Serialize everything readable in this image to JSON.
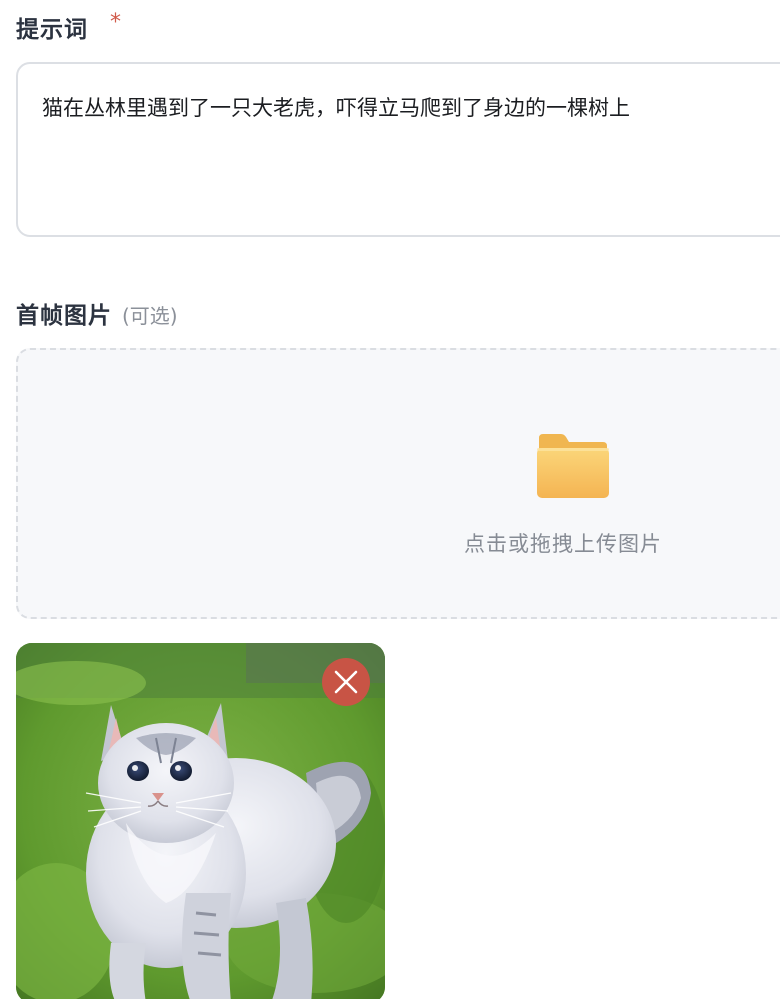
{
  "prompt": {
    "label": "提示词",
    "required_mark": "*",
    "value": "猫在丛林里遇到了一只大老虎，吓得立马爬到了身边的一棵树上"
  },
  "first_frame": {
    "label": "首帧图片",
    "optional_label": "(可选)",
    "upload_hint": "点击或拖拽上传图片",
    "upload_icon": "folder-icon",
    "uploaded_image": {
      "subject": "fluffy grey-white cat walking on green moss",
      "remove_icon": "close-icon"
    }
  },
  "colors": {
    "label_text": "#2c3340",
    "required": "#d05a4a",
    "remove_button": "#c85445",
    "folder": "#f7c45a"
  }
}
